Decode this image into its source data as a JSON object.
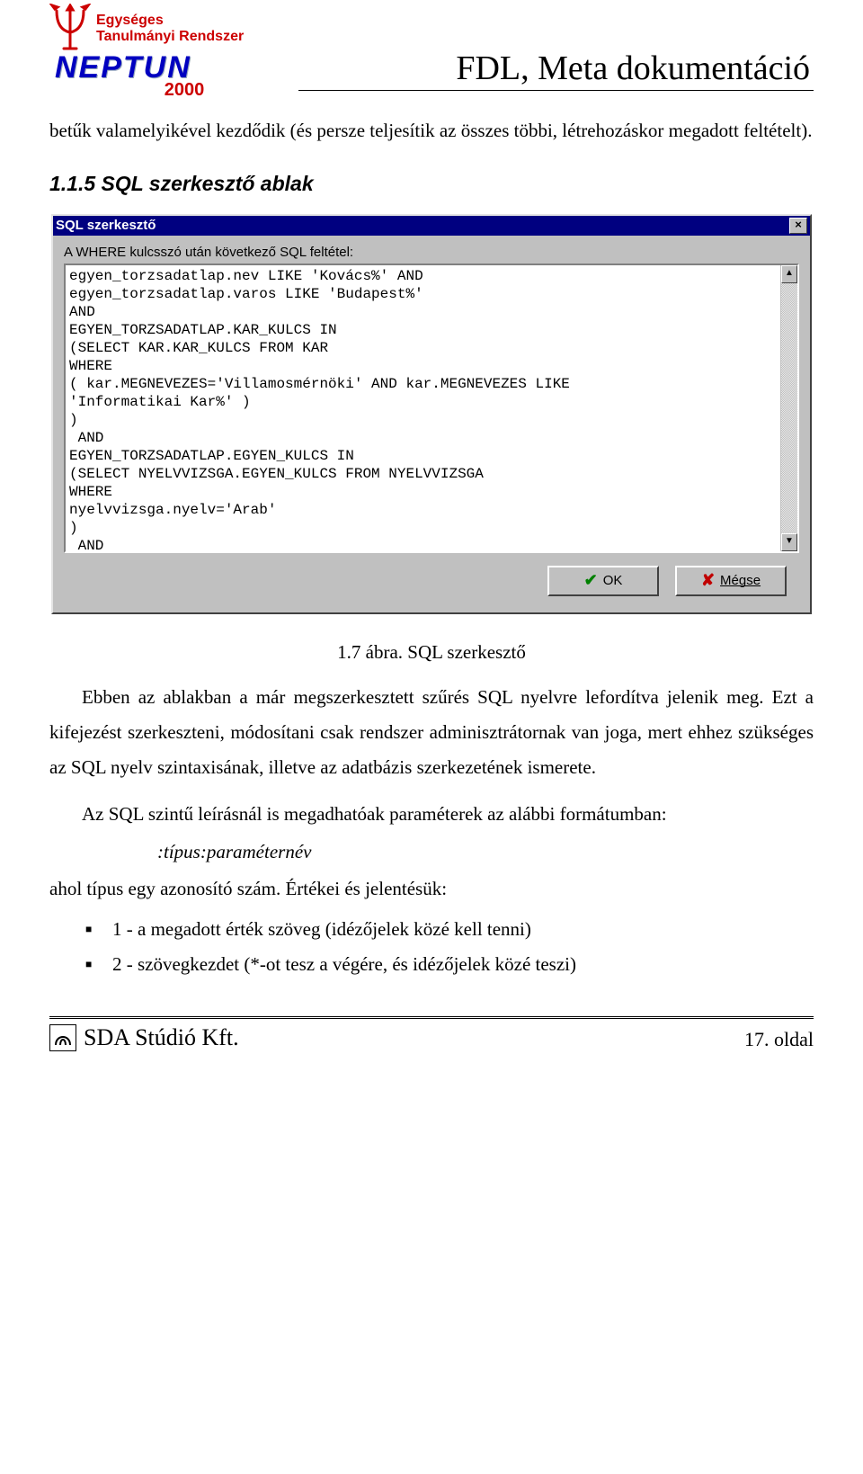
{
  "header": {
    "logo_line1": "Egységes",
    "logo_line2": "Tanulmányi Rendszer",
    "logo_brand": "NEPTUN",
    "logo_year": "2000",
    "doc_title": "FDL, Meta dokumentáció"
  },
  "intro_para": "betűk valamelyikével kezdődik (és persze teljesítik az összes többi, létrehozáskor megadott feltételt).",
  "section_heading": "1.1.5  SQL szerkesztő ablak",
  "window": {
    "title": "SQL szerkesztő",
    "label": "A WHERE kulcsszó után következő SQL feltétel:",
    "sql": "egyen_torzsadatlap.nev LIKE 'Kovács%' AND\negyen_torzsadatlap.varos LIKE 'Budapest%'\nAND\nEGYEN_TORZSADATLAP.KAR_KULCS IN\n(SELECT KAR.KAR_KULCS FROM KAR\nWHERE\n( kar.MEGNEVEZES='Villamosmérnöki' AND kar.MEGNEVEZES LIKE\n'Informatikai Kar%' )\n)\n AND\nEGYEN_TORZSADATLAP.EGYEN_KULCS IN\n(SELECT NYELVVIZSGA.EGYEN_KULCS FROM NYELVVIZSGA\nWHERE\nnyelvvizsga.nyelv='Arab'\n)\n AND\nEGYEN_TORZSADATLAP.EGYEN_KULCS IN\n(SELECT KEPZES_HALLGATOI_ADATLAP.EGYEN_KULCS FROM\nKEPZES_HALLGATOI_ADATLAP",
    "ok_label": "OK",
    "cancel_label": "Mégse"
  },
  "figure_caption": "1.7 ábra. SQL szerkesztő",
  "body": {
    "p1": "Ebben az ablakban a már megszerkesztett szűrés SQL nyelvre lefordítva jelenik meg. Ezt a kifejezést szerkeszteni, módosítani csak rendszer adminisztrátornak van joga, mert ehhez szükséges az SQL nyelv szintaxisának, illetve az adatbázis szerkezetének ismerete.",
    "p2": "Az SQL szintű leírásnál is megadhatóak paraméterek az alábbi formátumban:",
    "param_format": ":típus:paraméternév",
    "p3": "ahol típus egy azonosító szám. Értékei és jelentésük:",
    "bullets": [
      "1  - a megadott érték szöveg (idézőjelek közé kell tenni)",
      "2  - szövegkezdet (*-ot tesz a végére, és idézőjelek közé teszi)"
    ]
  },
  "footer": {
    "company": "SDA Stúdió Kft.",
    "page": "17. oldal"
  }
}
